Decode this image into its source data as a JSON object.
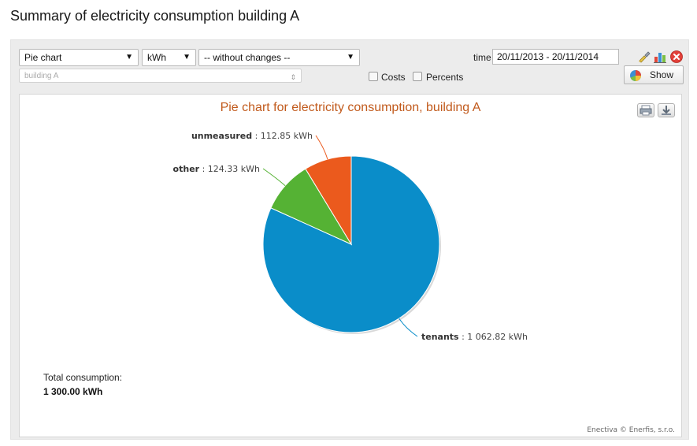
{
  "page": {
    "title": "Summary of electricity consumption building A"
  },
  "controls": {
    "chart_type": "Pie chart",
    "unit": "kWh",
    "change_mode": "-- without changes --",
    "building": "building A",
    "time_label": "time",
    "time_value": "20/11/2013 - 20/11/2014",
    "costs_label": "Costs",
    "percents_label": "Percents",
    "show_label": "Show"
  },
  "icons": {
    "brush": "brush-icon",
    "chart": "bar-chart-icon",
    "close": "close-icon",
    "print": "print-icon",
    "download": "download-icon",
    "show": "pie-chart-icon"
  },
  "chart_data": {
    "type": "pie",
    "title": "Pie chart for electricity consumption, building A",
    "unit": "kWh",
    "slices": [
      {
        "name": "tenants",
        "value": 1062.82,
        "value_label": "1 062.82 kWh",
        "color": "#0a8dc9"
      },
      {
        "name": "other",
        "value": 124.33,
        "value_label": "124.33 kWh",
        "color": "#55b234"
      },
      {
        "name": "unmeasured",
        "value": 112.85,
        "value_label": "112.85 kWh",
        "color": "#eb5a1d"
      }
    ]
  },
  "summary": {
    "total_label": "Total consumption:",
    "total_value": "1 300.00 kWh"
  },
  "credits": "Enectiva © Enerfis, s.r.o."
}
